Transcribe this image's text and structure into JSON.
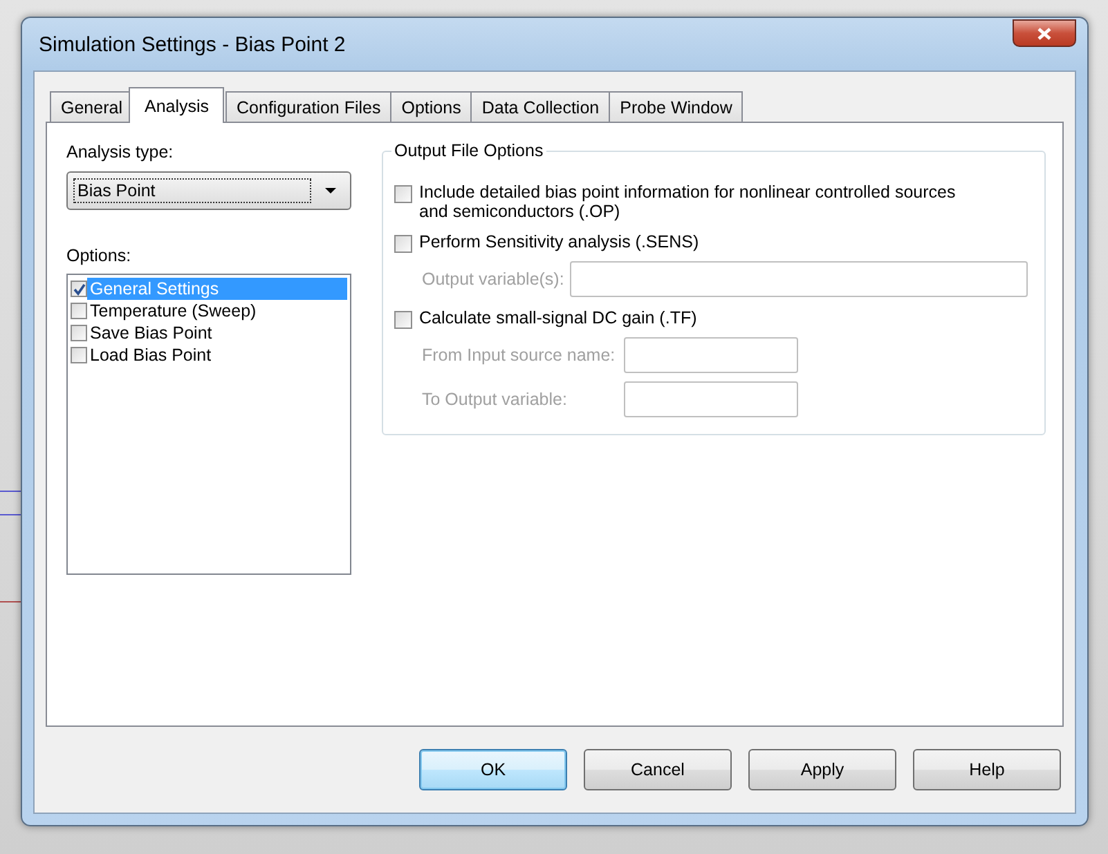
{
  "window": {
    "title": "Simulation Settings - Bias Point 2"
  },
  "tabs": [
    {
      "label": "General",
      "selected": false
    },
    {
      "label": "Analysis",
      "selected": true
    },
    {
      "label": "Configuration Files",
      "selected": false
    },
    {
      "label": "Options",
      "selected": false
    },
    {
      "label": "Data Collection",
      "selected": false
    },
    {
      "label": "Probe Window",
      "selected": false
    }
  ],
  "analysis_type": {
    "label": "Analysis type:",
    "value": "Bias Point"
  },
  "options": {
    "label": "Options:",
    "items": [
      {
        "label": "General Settings",
        "checked": true,
        "selected": true
      },
      {
        "label": "Temperature (Sweep)",
        "checked": false,
        "selected": false
      },
      {
        "label": "Save Bias Point",
        "checked": false,
        "selected": false
      },
      {
        "label": "Load Bias Point",
        "checked": false,
        "selected": false
      }
    ]
  },
  "output_file_options": {
    "title": "Output File Options",
    "sections": [
      {
        "label": "Include detailed bias point information for nonlinear controlled sources and semiconductors (.OP)",
        "checked": false
      },
      {
        "label": "Perform Sensitivity analysis (.SENS)",
        "checked": false,
        "fields": [
          {
            "label": "Output variable(s):",
            "disabled": true,
            "kind": "wide"
          }
        ]
      },
      {
        "label": "Calculate small-signal DC gain (.TF)",
        "checked": false,
        "fields": [
          {
            "label": "From Input source name:",
            "disabled": true,
            "kind": "short"
          },
          {
            "label": "To Output variable:",
            "disabled": true,
            "kind": "short"
          }
        ]
      }
    ]
  },
  "buttons": [
    {
      "label": "OK",
      "default": true
    },
    {
      "label": "Cancel",
      "default": false
    },
    {
      "label": "Apply",
      "default": false
    },
    {
      "label": "Help",
      "default": false
    }
  ]
}
